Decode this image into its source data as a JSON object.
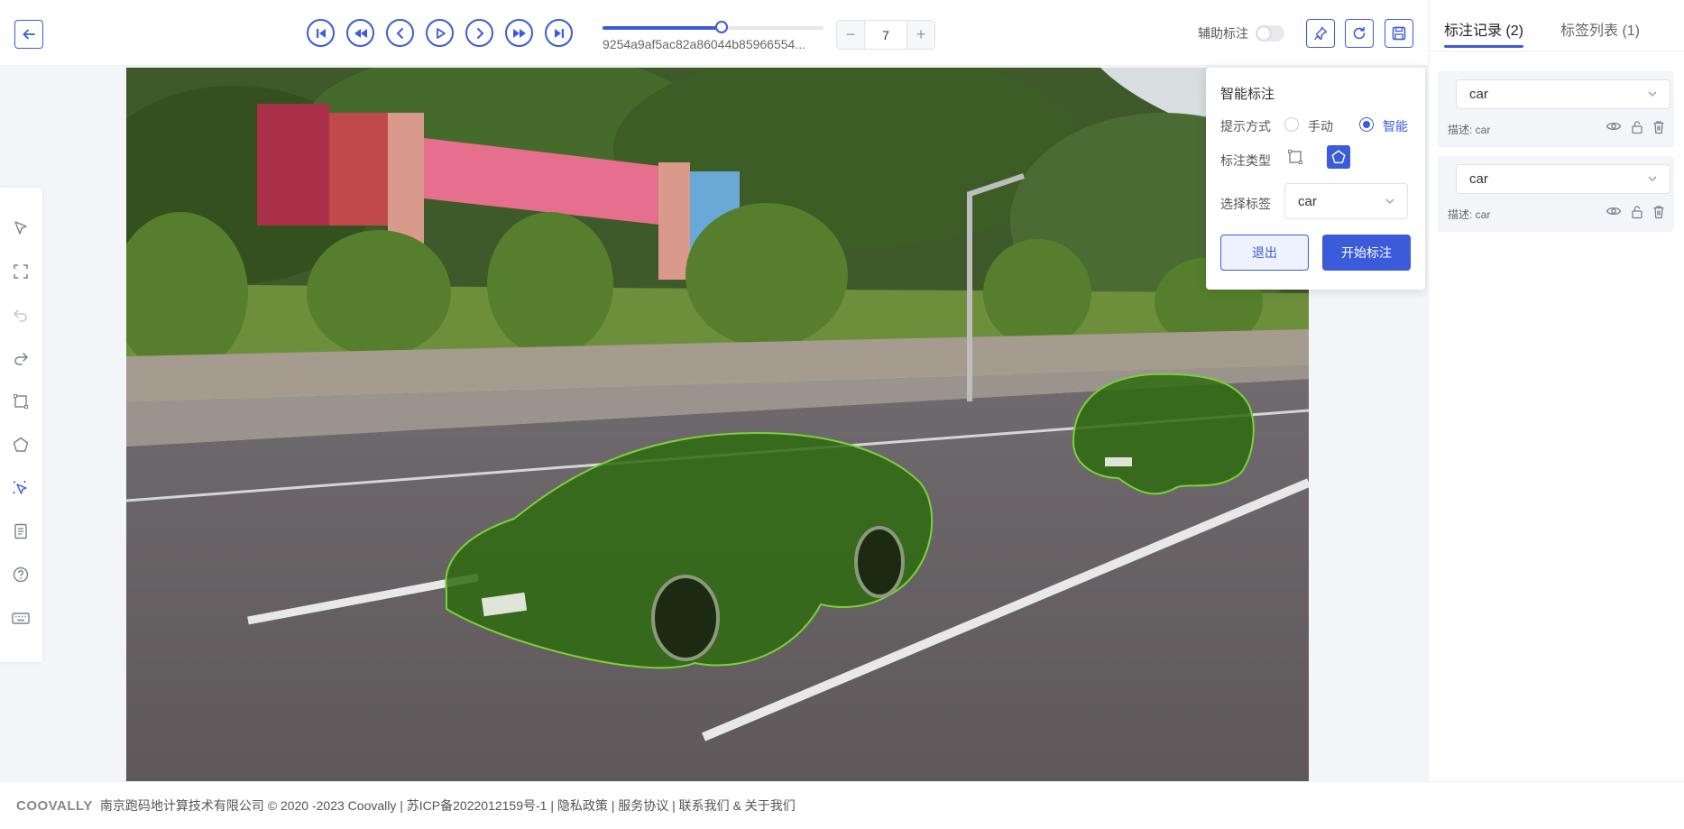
{
  "topbar": {
    "frame_id": "9254a9af5ac82a86044b85966554...",
    "frame_number": "7",
    "stepper_minus": "−",
    "stepper_plus": "+",
    "frame_progress_percent": 54,
    "assist_label": "辅助标注",
    "assist_on": false
  },
  "popover": {
    "title": "智能标注",
    "hint_label": "提示方式",
    "hint_options": [
      "手动",
      "智能"
    ],
    "hint_selected": "智能",
    "type_label": "标注类型",
    "tag_label": "选择标签",
    "tag_value": "car",
    "exit_label": "退出",
    "start_label": "开始标注"
  },
  "rightpanel": {
    "tabs": [
      {
        "label": "标注记录 (2)",
        "active": true
      },
      {
        "label": "标签列表 (1)",
        "active": false
      }
    ],
    "records": [
      {
        "tag": "car",
        "desc": "描述: car"
      },
      {
        "tag": "car",
        "desc": "描述: car"
      }
    ]
  },
  "footer": {
    "logo": "COOVALLY",
    "text": "南京跑码地计算技术有限公司 © 2020 -2023 Coovally | 苏ICP备2022012159号-1 | 隐私政策 | 服务协议 | 联系我们 & 关于我们"
  },
  "colors": {
    "accent": "#3b5bdb",
    "mask_fill": "#2f6b10",
    "mask_outline": "#7bd13a"
  },
  "icons": {
    "back": "arrow-left-icon",
    "first": "skip-first-icon",
    "fast_back": "fast-backward-icon",
    "prev": "chevron-left-icon",
    "play": "play-icon",
    "next": "chevron-right-icon",
    "fast_forward": "fast-forward-icon",
    "last": "skip-last-icon",
    "pin": "pin-icon",
    "refresh": "refresh-icon",
    "save": "save-icon"
  }
}
